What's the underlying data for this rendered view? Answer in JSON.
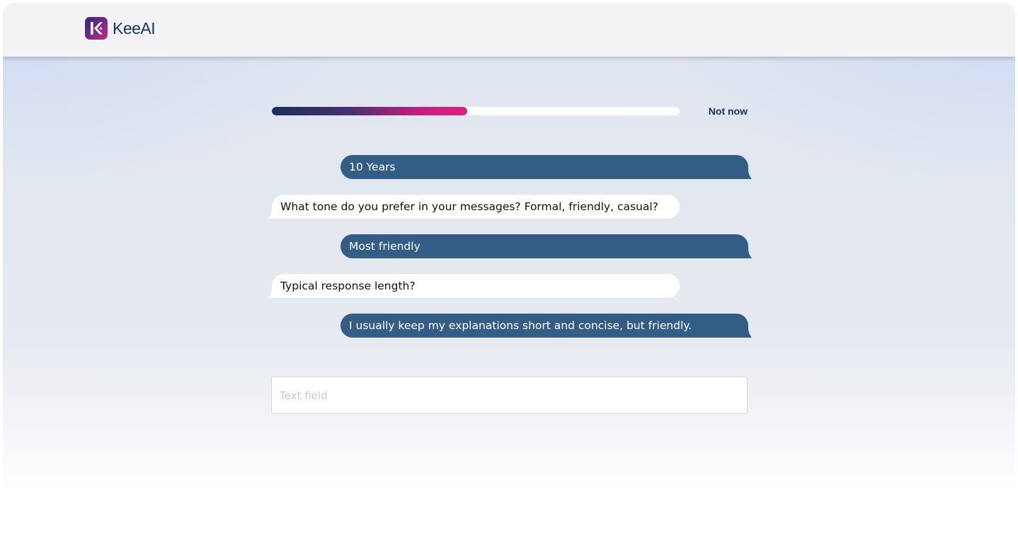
{
  "app": {
    "logo_text": "KeeAI"
  },
  "progress": {
    "fraction": 0.48
  },
  "header_actions": {
    "not_now_label": "Not now"
  },
  "messages": [
    {
      "role": "user",
      "text": "10 Years"
    },
    {
      "role": "assistant",
      "text": "What tone do you prefer in your messages? Formal, friendly, casual?"
    },
    {
      "role": "user",
      "text": "Most friendly"
    },
    {
      "role": "assistant",
      "text": "Typical response length?"
    },
    {
      "role": "user",
      "text": "I usually keep my explanations short and concise, but friendly."
    }
  ],
  "composer": {
    "placeholder": "Text field",
    "value": ""
  },
  "colors": {
    "user_bubble": "#335d85",
    "assistant_bubble": "#ffffff",
    "brand_navy": "#16325c",
    "brand_pink": "#e0207f"
  }
}
